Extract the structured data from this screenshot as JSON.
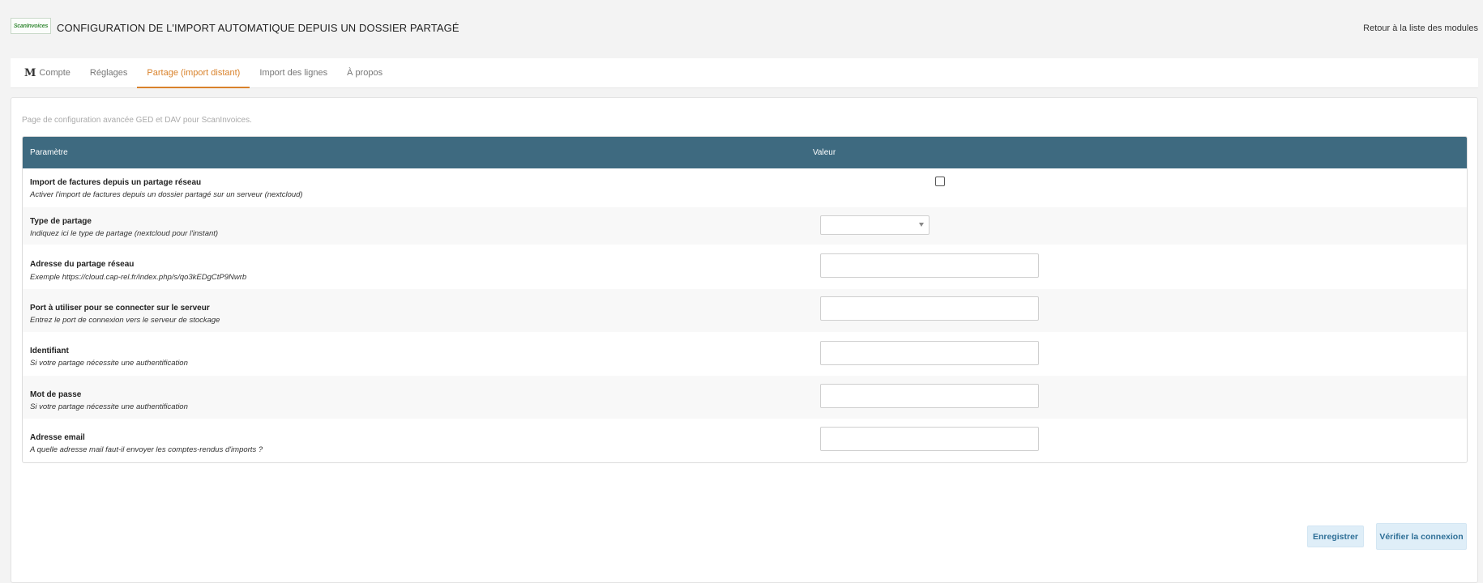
{
  "header": {
    "logo_text": "ScanInvoices",
    "title": "CONFIGURATION DE L'IMPORT AUTOMATIQUE DEPUIS UN DOSSIER PARTAGÉ",
    "back_link": "Retour à la liste des modules"
  },
  "tabs": [
    {
      "label": "Compte",
      "icon": "m-logo-icon"
    },
    {
      "label": "Réglages"
    },
    {
      "label": "Partage (import distant)",
      "active": true
    },
    {
      "label": "Import des lignes"
    },
    {
      "label": "À propos"
    }
  ],
  "tab_icon_text": "M",
  "intro": "Page de configuration avancée GED et DAV pour ScanInvoices.",
  "table": {
    "col_param": "Paramètre",
    "col_value": "Valeur",
    "rows": [
      {
        "label": "Import de factures depuis un partage réseau",
        "desc": "Activer l'import de factures depuis un dossier partagé sur un serveur (nextcloud)",
        "control": "checkbox",
        "checked": false
      },
      {
        "label": "Type de partage",
        "desc": "Indiquez ici le type de partage (nextcloud pour l'instant)",
        "control": "select",
        "value": ""
      },
      {
        "label": "Adresse du partage réseau",
        "desc": "Exemple https://cloud.cap-rel.fr/index.php/s/qo3kEDgCtP9Nwrb",
        "control": "text",
        "value": ""
      },
      {
        "label": "Port à utiliser pour se connecter sur le serveur",
        "desc": "Entrez le port de connexion vers le serveur de stockage",
        "control": "text",
        "value": ""
      },
      {
        "label": "Identifiant",
        "desc": "Si votre partage nécessite une authentification",
        "control": "text",
        "value": ""
      },
      {
        "label": "Mot de passe",
        "desc": "Si votre partage nécessite une authentification",
        "control": "text",
        "value": ""
      },
      {
        "label": "Adresse email",
        "desc": "A quelle adresse mail faut-il envoyer les comptes-rendus d'imports ?",
        "control": "text",
        "value": ""
      }
    ]
  },
  "buttons": {
    "save": "Enregistrer",
    "verify": "Vérifier la connexion"
  },
  "colors": {
    "table_header": "#3e6a80",
    "active_tab": "#d9822b",
    "button_bg": "#dfeef8",
    "button_text": "#2e6f97"
  }
}
